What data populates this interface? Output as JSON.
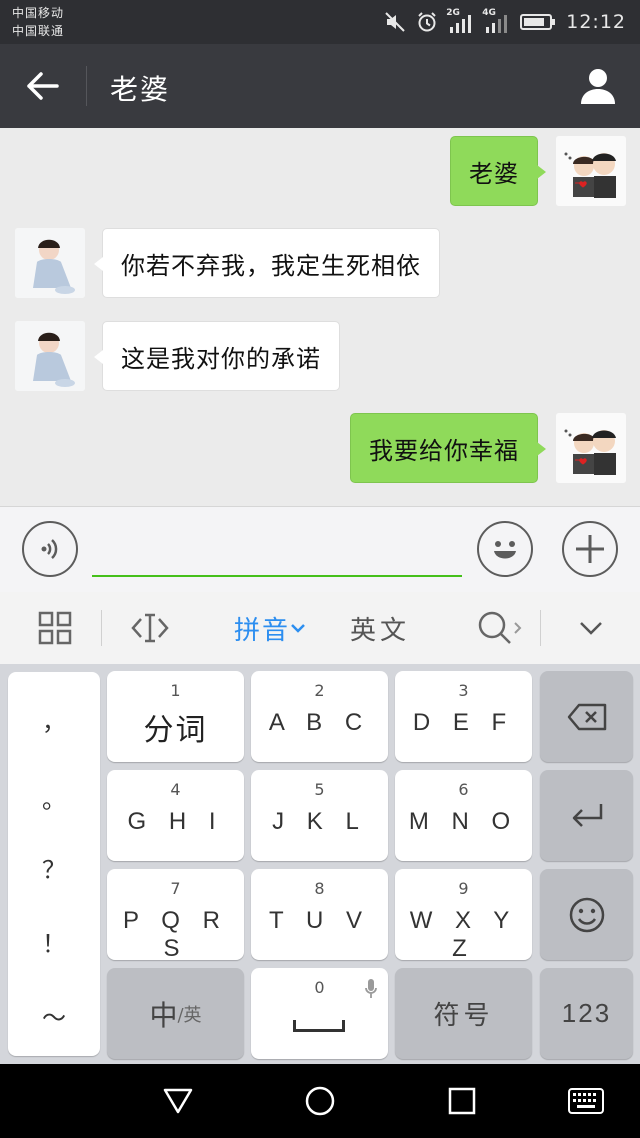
{
  "status_bar": {
    "carrier_1": "中国移动",
    "carrier_2": "中国联通",
    "network_1": "2G",
    "network_2": "4G",
    "time": "12:12",
    "icons": [
      "mute-icon",
      "alarm-icon",
      "signal-icon",
      "signal-icon",
      "battery-icon"
    ]
  },
  "header": {
    "title": "老婆",
    "back_icon": "arrow-left-icon",
    "profile_icon": "person-icon"
  },
  "messages": [
    {
      "direction": "out",
      "text": "老婆"
    },
    {
      "direction": "in",
      "text": "你若不弃我，我定生死相依"
    },
    {
      "direction": "in",
      "text": "这是我对你的承诺"
    },
    {
      "direction": "out",
      "text": "我要给你幸福"
    }
  ],
  "input_bar": {
    "value": "",
    "voice_icon": "voice-icon",
    "emoji_icon": "emoji-icon",
    "plus_icon": "plus-icon"
  },
  "ime_toolbar": {
    "mode_pinyin": "拼音",
    "mode_english": "英文",
    "icons": [
      "grid-icon",
      "cursor-icon",
      "search-icon",
      "chevron-down-icon"
    ]
  },
  "keyboard": {
    "punctuation": [
      "，",
      "。",
      "？",
      "！",
      "～"
    ],
    "keys": [
      {
        "num": "1",
        "label": "分词"
      },
      {
        "num": "2",
        "label": "A B C"
      },
      {
        "num": "3",
        "label": "D E F"
      },
      {
        "num": "4",
        "label": "G H I"
      },
      {
        "num": "5",
        "label": "J K L"
      },
      {
        "num": "6",
        "label": "M N O"
      },
      {
        "num": "7",
        "label": "P Q R S"
      },
      {
        "num": "8",
        "label": "T U V"
      },
      {
        "num": "9",
        "label": "W X Y Z"
      },
      {
        "num": "0",
        "label": ""
      }
    ],
    "lang_key_main": "中",
    "lang_key_sub": "/英",
    "symbols_key": "符号",
    "numbers_key": "123"
  },
  "colors": {
    "title_bar": "#393a3f",
    "outgoing_bubble": "#8fda5a",
    "accent_blue": "#2c8ef0",
    "input_underline": "#45c01a"
  }
}
